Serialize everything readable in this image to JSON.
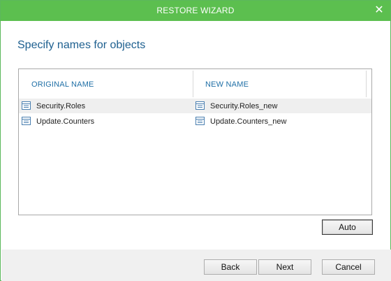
{
  "window": {
    "title": "RESTORE WIZARD",
    "close_glyph": "✕"
  },
  "page": {
    "heading": "Specify names for objects"
  },
  "table": {
    "headers": {
      "original": "ORIGINAL NAME",
      "new": "NEW NAME"
    },
    "rows": [
      {
        "original": "Security.Roles",
        "new": "Security.Roles_new",
        "selected": true
      },
      {
        "original": "Update.Counters",
        "new": "Update.Counters_new",
        "selected": false
      }
    ]
  },
  "buttons": {
    "auto": "Auto",
    "back": "Back",
    "next": "Next",
    "cancel": "Cancel"
  },
  "colors": {
    "titlebar": "#5cbf4f",
    "heading": "#1d5f8f",
    "header_text": "#1f6fa6"
  },
  "icons": {
    "row_icon": "table-object-icon"
  }
}
